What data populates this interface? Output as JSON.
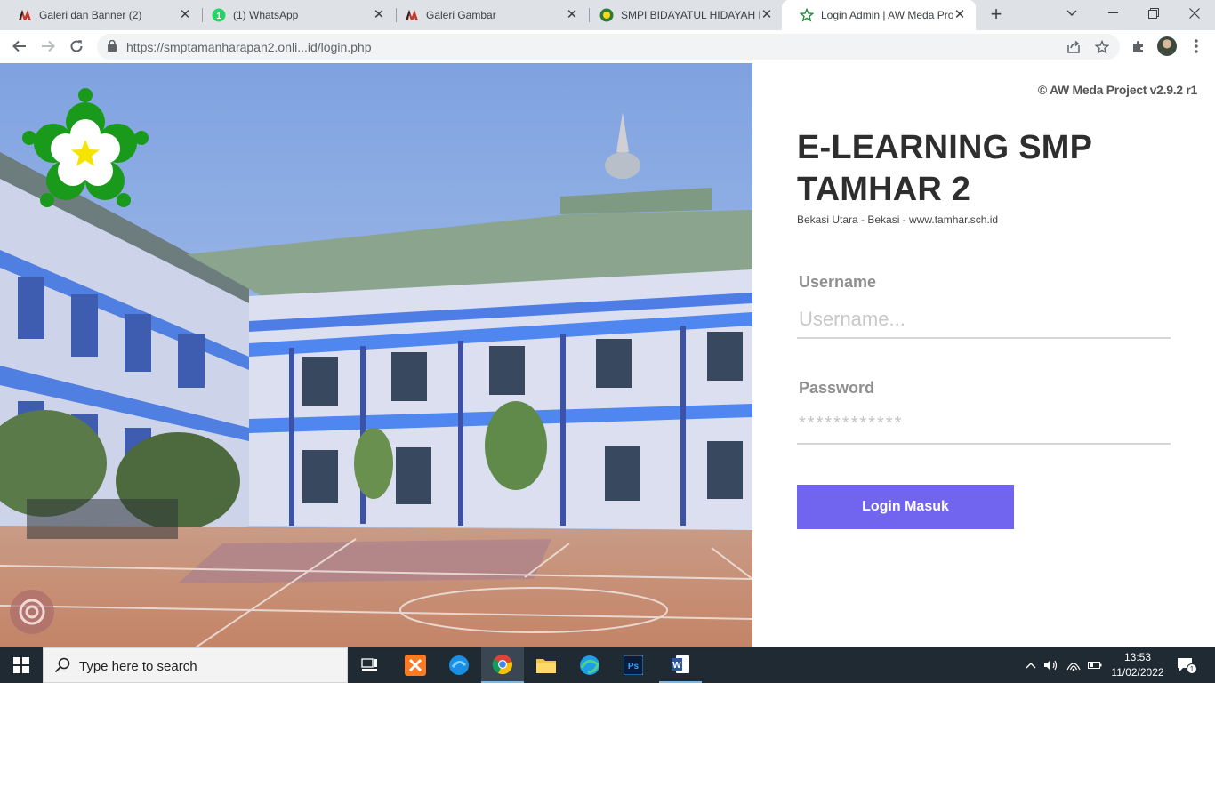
{
  "browser": {
    "tabs": [
      {
        "title": "Galeri dan Banner (2)",
        "icon": "aw-logo-icon",
        "active": false
      },
      {
        "title": "(1) WhatsApp",
        "icon": "whatsapp-icon",
        "badge": "1",
        "active": false
      },
      {
        "title": "Galeri Gambar",
        "icon": "aw-logo-icon",
        "active": false
      },
      {
        "title": "SMPI BIDAYATUL HIDAYAH B",
        "icon": "school-logo-icon",
        "active": false
      },
      {
        "title": "Login Admin | AW Meda Proj",
        "icon": "star-outline-icon",
        "active": true
      }
    ],
    "url": "https://smptamanharapan2.onli...id/login.php"
  },
  "login": {
    "copyright": "© AW Meda Project v2.9.2 r1",
    "title": "E-LEARNING SMP TAMHAR 2",
    "subtitle": "Bekasi Utara - Bekasi - www.tamhar.sch.id",
    "username_label": "Username",
    "username_placeholder": "Username...",
    "password_label": "Password",
    "password_placeholder": "************",
    "button_label": "Login Masuk",
    "accent_color": "#7164ef"
  },
  "taskbar": {
    "search_placeholder": "Type here to search",
    "apps": [
      "task-view-icon",
      "xampp-icon",
      "edge-dev-icon",
      "chrome-icon",
      "file-explorer-icon",
      "edge-icon",
      "photoshop-icon",
      "word-icon"
    ],
    "time": "13:53",
    "date": "11/02/2022",
    "notification_count": "1"
  }
}
